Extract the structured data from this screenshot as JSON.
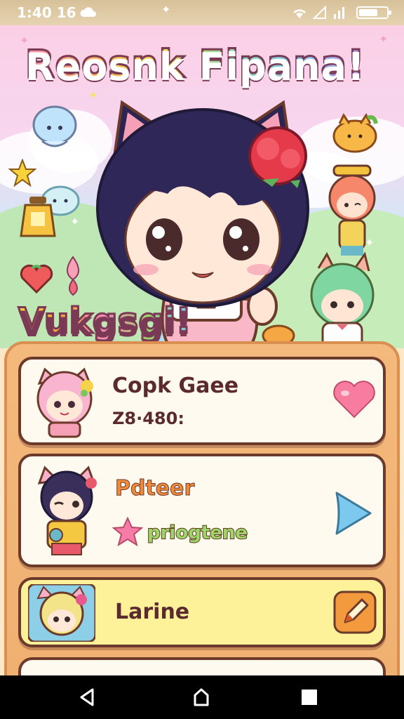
{
  "status": {
    "time": "1:40 16"
  },
  "hero": {
    "title": "Reosnk Fipana!",
    "subtitle": "Vukgsgi!"
  },
  "cards": [
    {
      "title": "Copk Gaee",
      "subtitle": "Z8·480:",
      "action_icon": "heart-icon"
    },
    {
      "title": "Pdteer",
      "tag": "priogtene",
      "action_icon": "play-arrow-icon"
    },
    {
      "title": "Larine",
      "action_icon": "edit-pen-icon"
    }
  ],
  "colors": {
    "panel": "#f4b97c",
    "card_border": "#6b3a2a",
    "heart": "#f77ca0",
    "play": "#7cc8ee",
    "edit_button": "#f39a3e"
  }
}
